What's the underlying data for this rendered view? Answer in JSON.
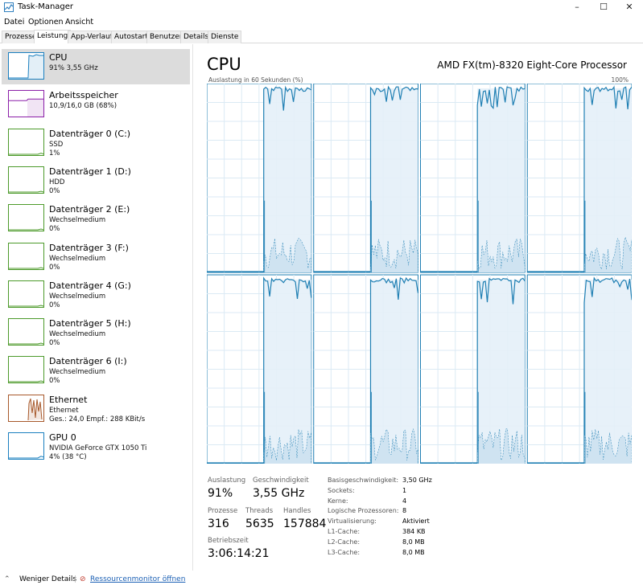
{
  "window": {
    "title": "Task-Manager",
    "controls": [
      "–",
      "☐",
      "✕"
    ]
  },
  "menu": [
    "Datei",
    "Optionen",
    "Ansicht"
  ],
  "tabs": [
    "Prozesse",
    "Leistung",
    "App-Verlauf",
    "Autostart",
    "Benutzer",
    "Details",
    "Dienste"
  ],
  "active_tab": "Leistung",
  "sidebar": {
    "items": [
      {
        "title": "CPU",
        "line1": "91% 3,55 GHz",
        "line2": "",
        "level": 0.91,
        "color": "#1a7fbf"
      },
      {
        "title": "Arbeitsspeicher",
        "line1": "10,9/16,0 GB (68%)",
        "line2": "",
        "level": 0.68,
        "color": "#8b1fa8"
      },
      {
        "title": "Datenträger 0 (C:)",
        "line1": "SSD",
        "line2": "1%",
        "level": 0.01,
        "color": "#4c9a2a"
      },
      {
        "title": "Datenträger 1 (D:)",
        "line1": "HDD",
        "line2": "0%",
        "level": 0.0,
        "color": "#4c9a2a"
      },
      {
        "title": "Datenträger 2 (E:)",
        "line1": "Wechselmedium",
        "line2": "0%",
        "level": 0.0,
        "color": "#4c9a2a"
      },
      {
        "title": "Datenträger 3 (F:)",
        "line1": "Wechselmedium",
        "line2": "0%",
        "level": 0.0,
        "color": "#4c9a2a"
      },
      {
        "title": "Datenträger 4 (G:)",
        "line1": "Wechselmedium",
        "line2": "0%",
        "level": 0.0,
        "color": "#4c9a2a"
      },
      {
        "title": "Datenträger 5 (H:)",
        "line1": "Wechselmedium",
        "line2": "0%",
        "level": 0.0,
        "color": "#4c9a2a"
      },
      {
        "title": "Datenträger 6 (I:)",
        "line1": "Wechselmedium",
        "line2": "0%",
        "level": 0.0,
        "color": "#4c9a2a"
      },
      {
        "title": "Ethernet",
        "line1": "Ethernet",
        "line2": "Ges.: 24,0  Empf.: 288 KBit/s",
        "level": 0.5,
        "color": "#a7582a"
      },
      {
        "title": "GPU 0",
        "line1": "NVIDIA GeForce GTX 1050 Ti",
        "line2": "4% (38 °C)",
        "level": 0.04,
        "color": "#1a7fbf"
      }
    ]
  },
  "main": {
    "title": "CPU",
    "model": "AMD FX(tm)-8320 Eight-Core Processor",
    "graph_label": "Auslastung in 60 Sekunden (%)",
    "graph_max": "100%",
    "stats": {
      "auslastung_label": "Auslastung",
      "auslastung": "91%",
      "geschwindigkeit_label": "Geschwindigkeit",
      "geschwindigkeit": "3,55 GHz",
      "prozesse_label": "Prozesse",
      "prozesse": "316",
      "threads_label": "Threads",
      "threads": "5635",
      "handles_label": "Handles",
      "handles": "157884",
      "betriebszeit_label": "Betriebszeit",
      "betriebszeit": "3:06:14:21"
    },
    "info": [
      {
        "key": "Basisgeschwindigkeit:",
        "value": "3,50 GHz"
      },
      {
        "key": "Sockets:",
        "value": "1"
      },
      {
        "key": "Kerne:",
        "value": "4"
      },
      {
        "key": "Logische Prozessoren:",
        "value": "8"
      },
      {
        "key": "Virtualisierung:",
        "value": "Aktiviert"
      },
      {
        "key": "L1-Cache:",
        "value": "384 KB"
      },
      {
        "key": "L2-Cache:",
        "value": "8,0 MB"
      },
      {
        "key": "L3-Cache:",
        "value": "8,0 MB"
      }
    ]
  },
  "footer": {
    "details": "Weniger Details",
    "monitor": "Ressourcenmonitor öffnen"
  },
  "colors": {
    "cpu_line": "#1f7fb3",
    "cpu_fill": "#e4f0f8",
    "grid": "#dbeaf4"
  }
}
